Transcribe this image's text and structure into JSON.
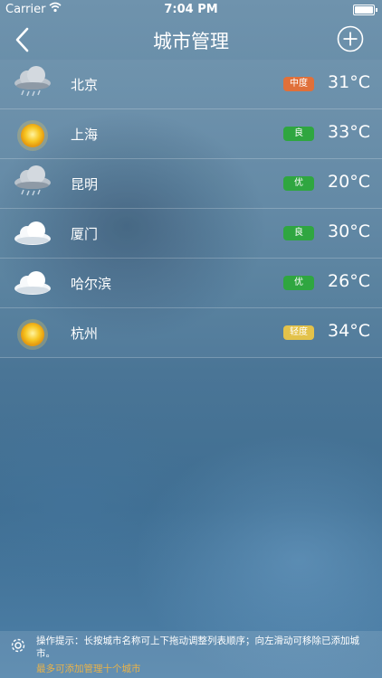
{
  "status_bar": {
    "carrier": "Carrier",
    "time": "7:04 PM"
  },
  "nav": {
    "title": "城市管理"
  },
  "cities": [
    {
      "name": "北京",
      "aqi": "中度",
      "aqi_color": "#e0703a",
      "temp": "31°C",
      "weather": "rain-cloud"
    },
    {
      "name": "上海",
      "aqi": "良",
      "aqi_color": "#2fa640",
      "temp": "33°C",
      "weather": "sun"
    },
    {
      "name": "昆明",
      "aqi": "优",
      "aqi_color": "#2fa640",
      "temp": "20°C",
      "weather": "rain-cloud"
    },
    {
      "name": "厦门",
      "aqi": "良",
      "aqi_color": "#2fa640",
      "temp": "30°C",
      "weather": "cloud"
    },
    {
      "name": "哈尔滨",
      "aqi": "优",
      "aqi_color": "#2fa640",
      "temp": "26°C",
      "weather": "cloud"
    },
    {
      "name": "杭州",
      "aqi": "轻度",
      "aqi_color": "#e3c24a",
      "temp": "34°C",
      "weather": "sun"
    }
  ],
  "footer": {
    "hint": "操作提示：长按城市名称可上下拖动调整列表顺序；向左滑动可移除已添加城市。",
    "limit": "最多可添加管理十个城市"
  }
}
